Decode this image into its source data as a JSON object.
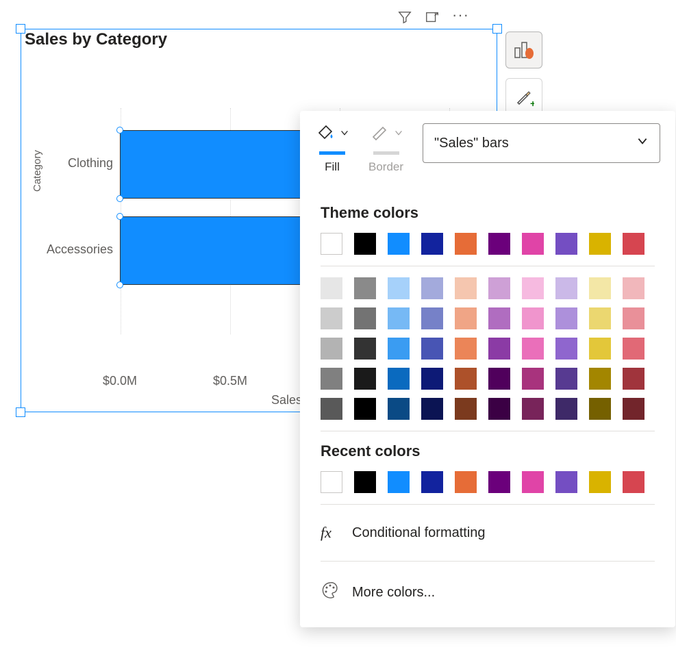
{
  "chart_data": {
    "type": "bar",
    "orientation": "horizontal",
    "title": "Sales by Category",
    "xlabel": "Sales",
    "ylabel": "Category",
    "categories": [
      "Clothing",
      "Accessories"
    ],
    "values": [
      1.1,
      0.9
    ],
    "x_ticks": [
      "$0.0M",
      "$0.5M"
    ],
    "x_tick_values": [
      0.0,
      0.5
    ],
    "xlim": [
      0,
      1.6
    ],
    "bar_color": "#118dff"
  },
  "toolbar": {
    "fill_label": "Fill",
    "border_label": "Border",
    "target_select": "\"Sales\" bars"
  },
  "color_picker": {
    "theme_title": "Theme colors",
    "recent_title": "Recent colors",
    "theme_main": [
      "#ffffff",
      "#000000",
      "#118dff",
      "#12239e",
      "#e66c37",
      "#6b007b",
      "#e044a7",
      "#744ec2",
      "#d9b300",
      "#d64550"
    ],
    "theme_shades": [
      [
        "#e6e6e6",
        "#8a8a8a",
        "#a6d1fa",
        "#a3aadc",
        "#f5c6af",
        "#cea0d6",
        "#f6bae0",
        "#cbb9e8",
        "#f3e7a6",
        "#f1b7bb"
      ],
      [
        "#cccccc",
        "#737373",
        "#76b9f5",
        "#7681c8",
        "#f0a586",
        "#b06dc0",
        "#f095cd",
        "#ad90db",
        "#ebd770",
        "#e99099"
      ],
      [
        "#b3b3b3",
        "#333333",
        "#3a9cf2",
        "#4855b4",
        "#eb8558",
        "#8b3ba5",
        "#ea6fba",
        "#8f66ce",
        "#e3c73a",
        "#e16976"
      ],
      [
        "#808080",
        "#1a1a1a",
        "#0a6abf",
        "#0d1a76",
        "#ad512a",
        "#50005c",
        "#a8337d",
        "#573a91",
        "#a38600",
        "#a0343c"
      ],
      [
        "#595959",
        "#000000",
        "#0a4a85",
        "#0b1453",
        "#7b3a1e",
        "#3b0044",
        "#78245a",
        "#3e2968",
        "#756000",
        "#72252b"
      ]
    ],
    "recent": [
      "#ffffff",
      "#000000",
      "#118dff",
      "#12239e",
      "#e66c37",
      "#6b007b",
      "#e044a7",
      "#744ec2",
      "#d9b300",
      "#d64550"
    ],
    "conditional_label": "Conditional formatting",
    "more_colors_label": "More colors..."
  }
}
